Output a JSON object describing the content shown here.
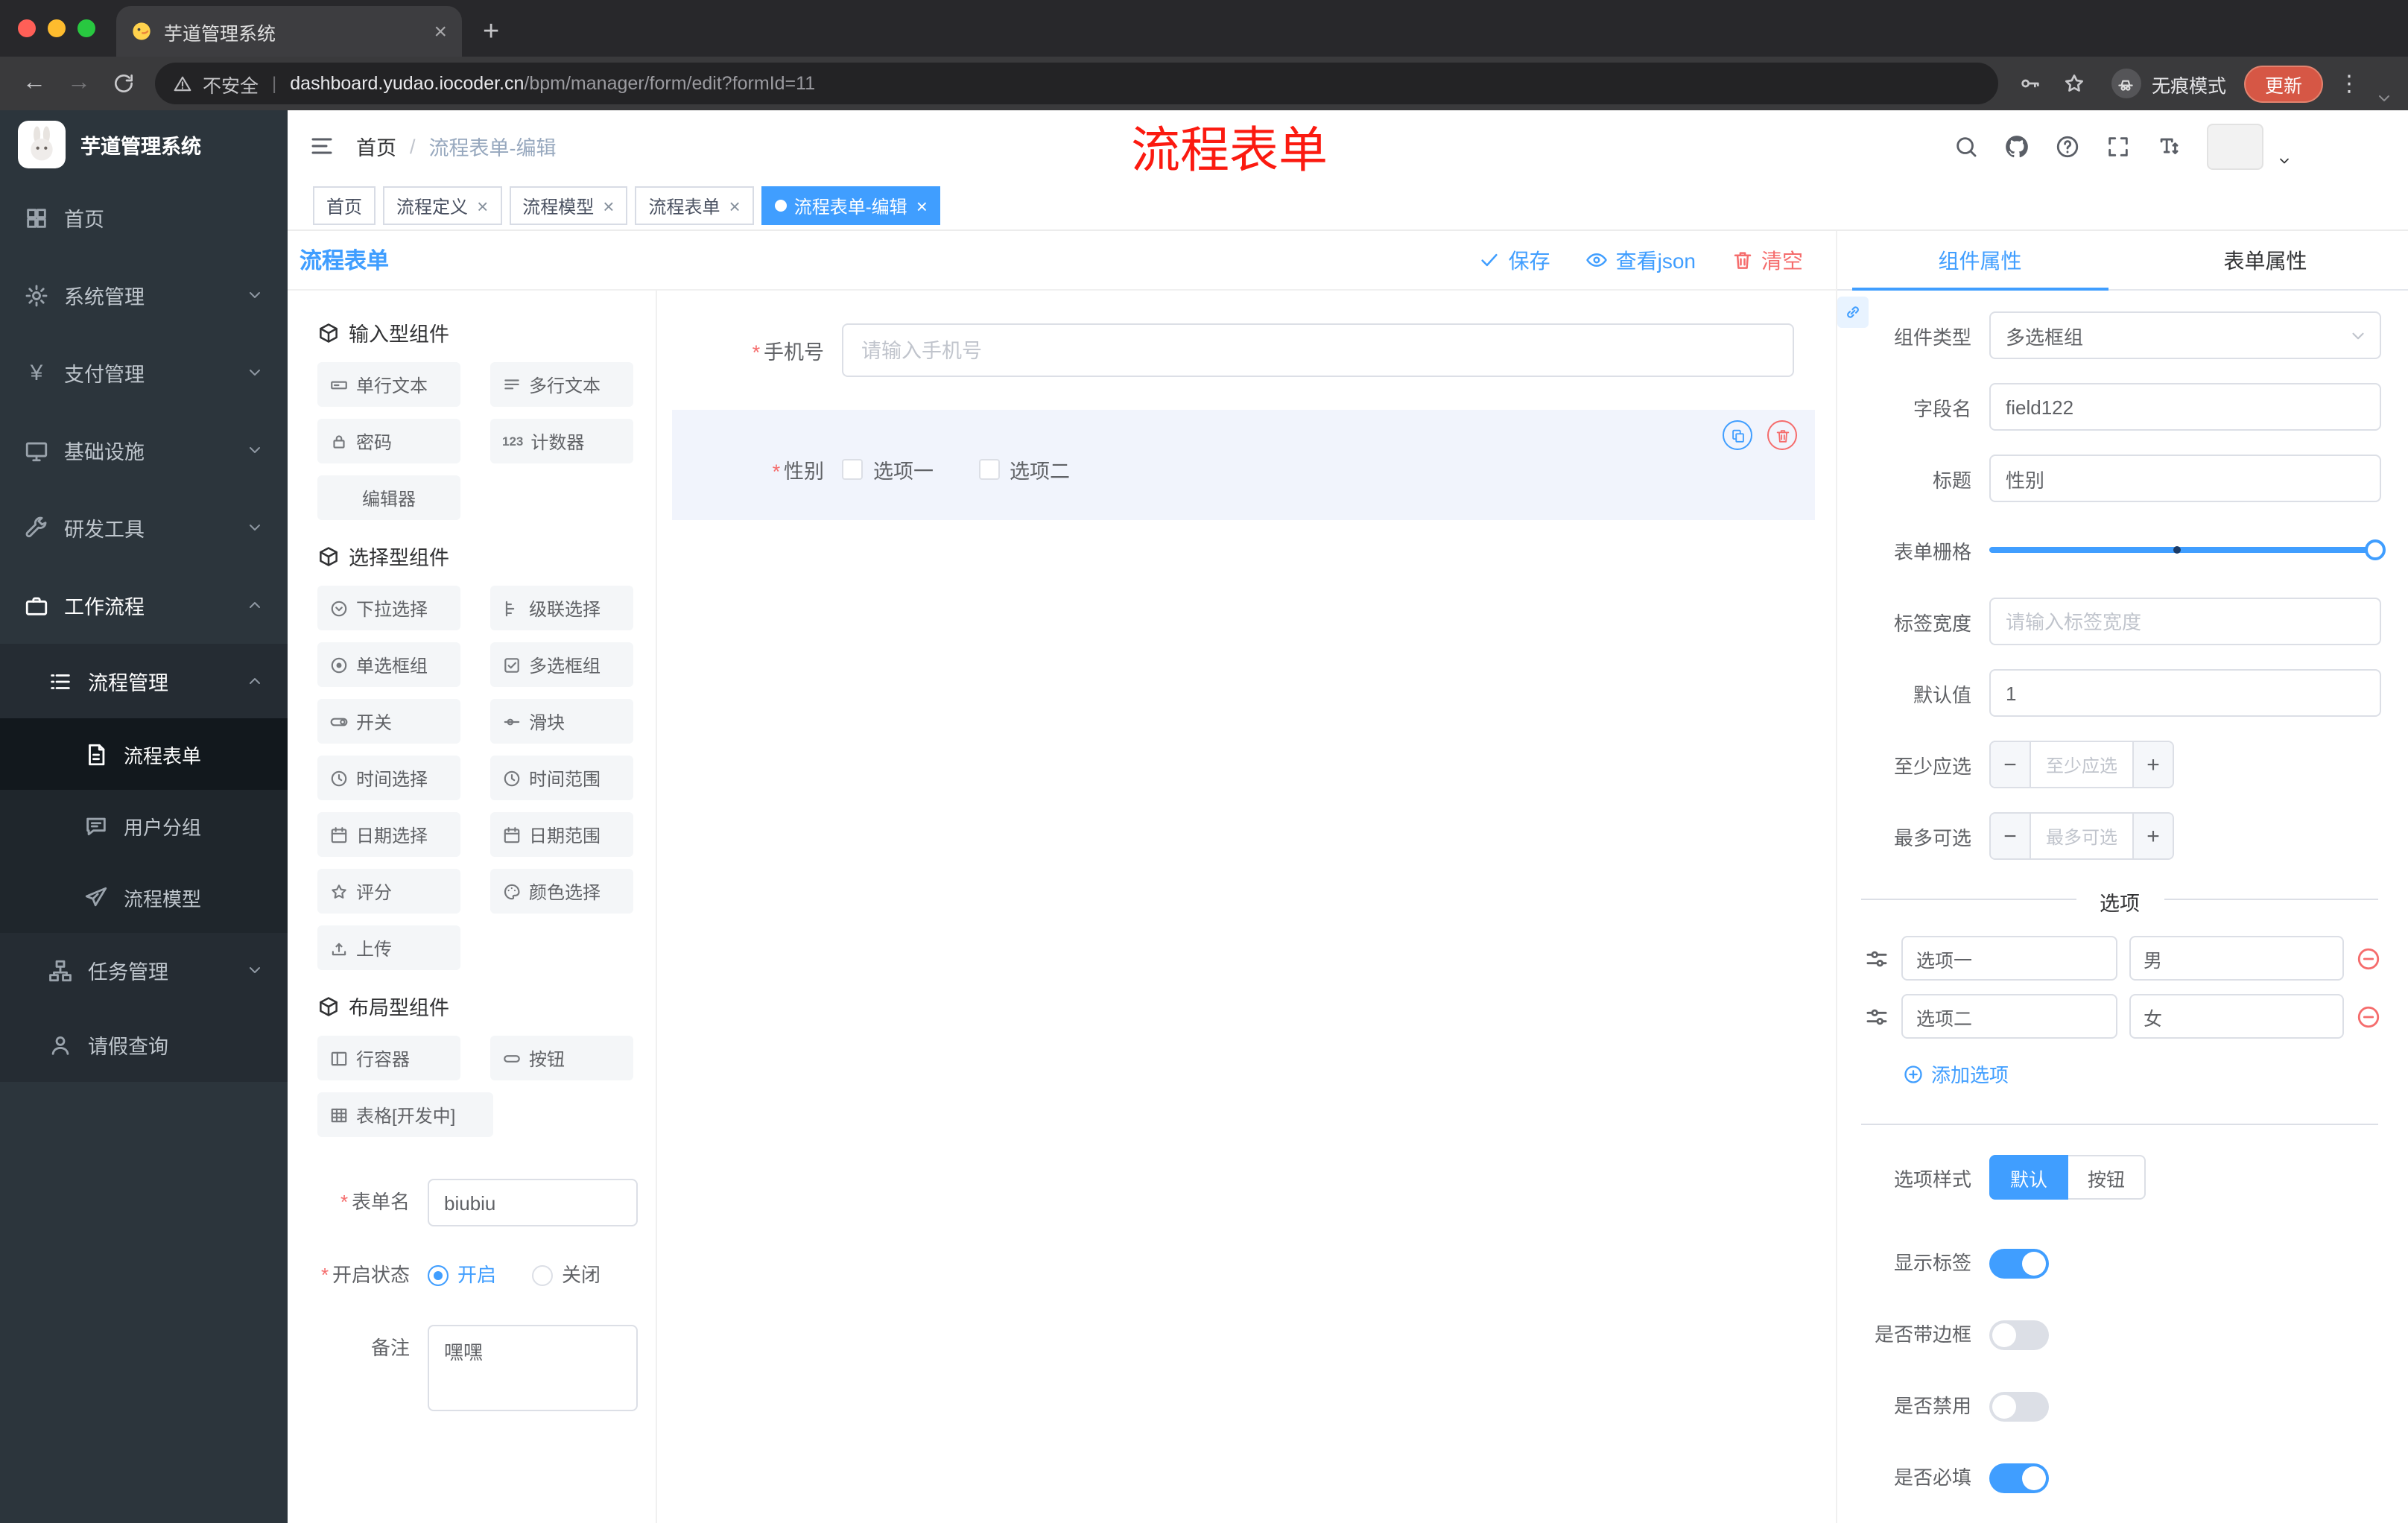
{
  "colors": {
    "primary": "#409eff",
    "danger": "#f56c6c",
    "update_button": "#d65745"
  },
  "browser": {
    "tab_title": "芋道管理系统",
    "security_label": "不安全",
    "url_domain": "dashboard.yudao.iocoder.cn",
    "url_path": "/bpm/manager/form/edit?formId=11",
    "incognito_label": "无痕模式",
    "update_label": "更新"
  },
  "annotation": {
    "text": "流程表单"
  },
  "sidebar": {
    "title": "芋道管理系统",
    "home": "首页",
    "system": "系统管理",
    "payment": "支付管理",
    "infra": "基础设施",
    "dev_tools": "研发工具",
    "workflow": "工作流程",
    "process_mgmt": "流程管理",
    "process_form": "流程表单",
    "user_group": "用户分组",
    "process_model": "流程模型",
    "task_mgmt": "任务管理",
    "leave_query": "请假查询"
  },
  "header": {
    "breadcrumb_home": "首页",
    "breadcrumb_current": "流程表单-编辑"
  },
  "tags": [
    {
      "label": "首页"
    },
    {
      "label": "流程定义"
    },
    {
      "label": "流程模型"
    },
    {
      "label": "流程表单"
    },
    {
      "label": "流程表单-编辑",
      "active": true
    }
  ],
  "designer": {
    "title": "流程表单",
    "save": "保存",
    "view_json": "查看json",
    "clear": "清空"
  },
  "components": {
    "groups": [
      {
        "title": "输入型组件",
        "items": [
          "单行文本",
          "多行文本",
          "密码",
          "计数器",
          "编辑器"
        ]
      },
      {
        "title": "选择型组件",
        "items": [
          "下拉选择",
          "级联选择",
          "单选框组",
          "多选框组",
          "开关",
          "滑块",
          "时间选择",
          "时间范围",
          "日期选择",
          "日期范围",
          "评分",
          "颜色选择",
          "上传"
        ]
      },
      {
        "title": "布局型组件",
        "items": [
          "行容器",
          "按钮",
          "表格[开发中]"
        ]
      }
    ]
  },
  "form_meta": {
    "name_label": "表单名",
    "name_value": "biubiu",
    "status_label": "开启状态",
    "status_on": "开启",
    "status_off": "关闭",
    "remark_label": "备注",
    "remark_value": "嘿嘿"
  },
  "canvas": {
    "phone_label": "手机号",
    "phone_placeholder": "请输入手机号",
    "gender_label": "性别",
    "gender_option1": "选项一",
    "gender_option2": "选项二"
  },
  "props": {
    "tab_component": "组件属性",
    "tab_form": "表单属性",
    "component_type_label": "组件类型",
    "component_type_value": "多选框组",
    "field_label": "字段名",
    "field_value": "field122",
    "title_label": "标题",
    "title_value": "性别",
    "grid_label": "表单栅格",
    "label_width_label": "标签宽度",
    "label_width_placeholder": "请输入标签宽度",
    "default_label": "默认值",
    "default_value": "1",
    "min_label": "至少应选",
    "min_placeholder": "至少应选",
    "max_label": "最多可选",
    "max_placeholder": "最多可选",
    "options_title": "选项",
    "option1_label": "选项一",
    "option1_value": "男",
    "option2_label": "选项二",
    "option2_value": "女",
    "add_option": "添加选项",
    "style_label": "选项样式",
    "style_default": "默认",
    "style_button": "按钮",
    "show_label": "显示标签",
    "border_label": "是否带边框",
    "disabled_label": "是否禁用",
    "required_label": "是否必填",
    "switch_states": {
      "show": true,
      "border": false,
      "disabled": false,
      "required": true
    }
  }
}
